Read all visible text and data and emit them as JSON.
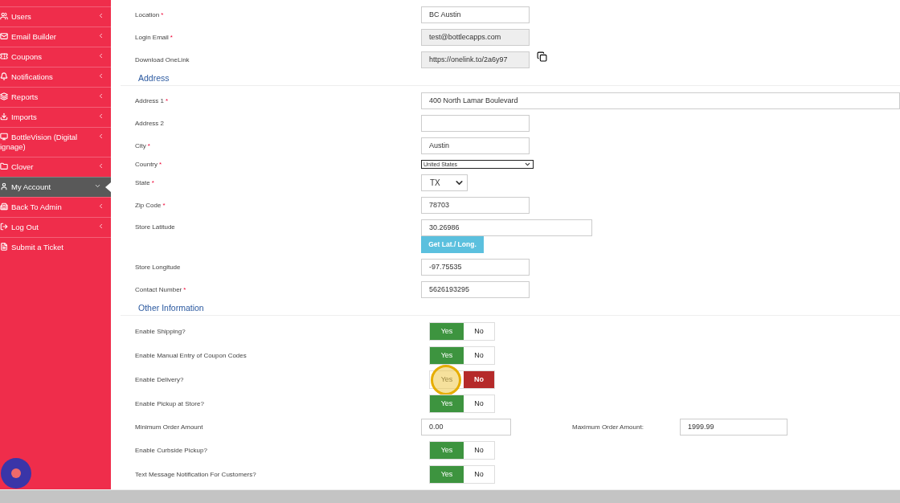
{
  "sidebar": {
    "items": [
      {
        "label": "Users",
        "selected": false,
        "expanded": false
      },
      {
        "label": "Email Builder",
        "selected": false,
        "expanded": false
      },
      {
        "label": "Coupons",
        "selected": false,
        "expanded": false
      },
      {
        "label": "Notifications",
        "selected": false,
        "expanded": false
      },
      {
        "label": "Reports",
        "selected": false,
        "expanded": false
      },
      {
        "label": "Imports",
        "selected": false,
        "expanded": false
      },
      {
        "label": "BottleVision (Digital ignage)",
        "selected": false,
        "expanded": false
      },
      {
        "label": "Clover",
        "selected": false,
        "expanded": false
      },
      {
        "label": "My Account",
        "selected": true,
        "expanded": true
      },
      {
        "label": "Back To Admin",
        "selected": false,
        "expanded": false
      },
      {
        "label": "Log Out",
        "selected": false,
        "expanded": false
      },
      {
        "label": "Submit a Ticket",
        "selected": false
      }
    ]
  },
  "form": {
    "sections": [
      {
        "fields": [
          {
            "kind": "text",
            "label": "Location",
            "required_mark": "*",
            "value": "BC Austin",
            "readonly": false
          },
          {
            "kind": "text",
            "label": "Login Email",
            "required_mark": "*",
            "value": "test@bottlecapps.com",
            "readonly": true
          },
          {
            "kind": "copy",
            "label": "Download OneLink",
            "value": "https://onelink.to/2a6y97",
            "readonly": true
          }
        ]
      },
      {
        "heading": "Address",
        "fields": [
          {
            "kind": "wide",
            "label": "Address 1",
            "required_mark": "*",
            "value": "400 North Lamar Boulevard",
            "readonly": false
          },
          {
            "kind": "text",
            "label": "Address 2",
            "readonly": false
          },
          {
            "kind": "text",
            "label": "City",
            "required_mark": "*",
            "value": "Austin",
            "readonly": false
          },
          {
            "kind": "select-small",
            "label": "Country",
            "required_mark": "*",
            "value": "United States"
          },
          {
            "kind": "select",
            "label": "State",
            "required_mark": "*",
            "value": "TX"
          },
          {
            "kind": "text",
            "label": "Zip Code",
            "required_mark": "*",
            "value": "78703",
            "readonly": false
          },
          {
            "kind": "geo",
            "label": "Store Latitude",
            "value": "30.26986",
            "readonly": false,
            "button": "Get Lat./ Long."
          },
          {
            "kind": "text",
            "label": "Store Longitude",
            "value": "-97.75535",
            "readonly": false
          },
          {
            "kind": "text",
            "label": "Contact Number",
            "required_mark": "*",
            "value": "5626193295",
            "readonly": false
          }
        ]
      },
      {
        "heading": "Other Information",
        "fields": [
          {
            "kind": "toggle",
            "label": "Enable Shipping?",
            "highlighted": false,
            "options": [
              {
                "label": "Yes",
                "selected": true
              },
              {
                "label": "No",
                "selected": false
              }
            ]
          },
          {
            "kind": "toggle",
            "label": "Enable Manual Entry of Coupon Codes",
            "highlighted": false,
            "options": [
              {
                "label": "Yes",
                "selected": true
              },
              {
                "label": "No",
                "selected": false
              }
            ]
          },
          {
            "kind": "toggle",
            "label": "Enable Delivery?",
            "highlighted": true,
            "options": [
              {
                "label": "Yes",
                "selected": false
              },
              {
                "label": "No",
                "selected": true
              }
            ]
          },
          {
            "kind": "toggle",
            "label": "Enable Pickup at Store?",
            "highlighted": false,
            "options": [
              {
                "label": "Yes",
                "selected": true
              },
              {
                "label": "No",
                "selected": false
              }
            ]
          },
          {
            "kind": "pair",
            "label": "Minimum Order Amount",
            "value": "0.00",
            "label_2": "Maximum Order Amount:",
            "value_2": "1999.99"
          },
          {
            "kind": "toggle",
            "label": "Enable Curbside Pickup?",
            "highlighted": false,
            "options": [
              {
                "label": "Yes",
                "selected": true
              },
              {
                "label": "No",
                "selected": false
              }
            ]
          },
          {
            "kind": "toggle",
            "label": "Text Message Notification For Customers?",
            "highlighted": false,
            "options": [
              {
                "label": "Yes",
                "selected": true
              },
              {
                "label": "No",
                "selected": false
              }
            ]
          }
        ]
      }
    ]
  }
}
